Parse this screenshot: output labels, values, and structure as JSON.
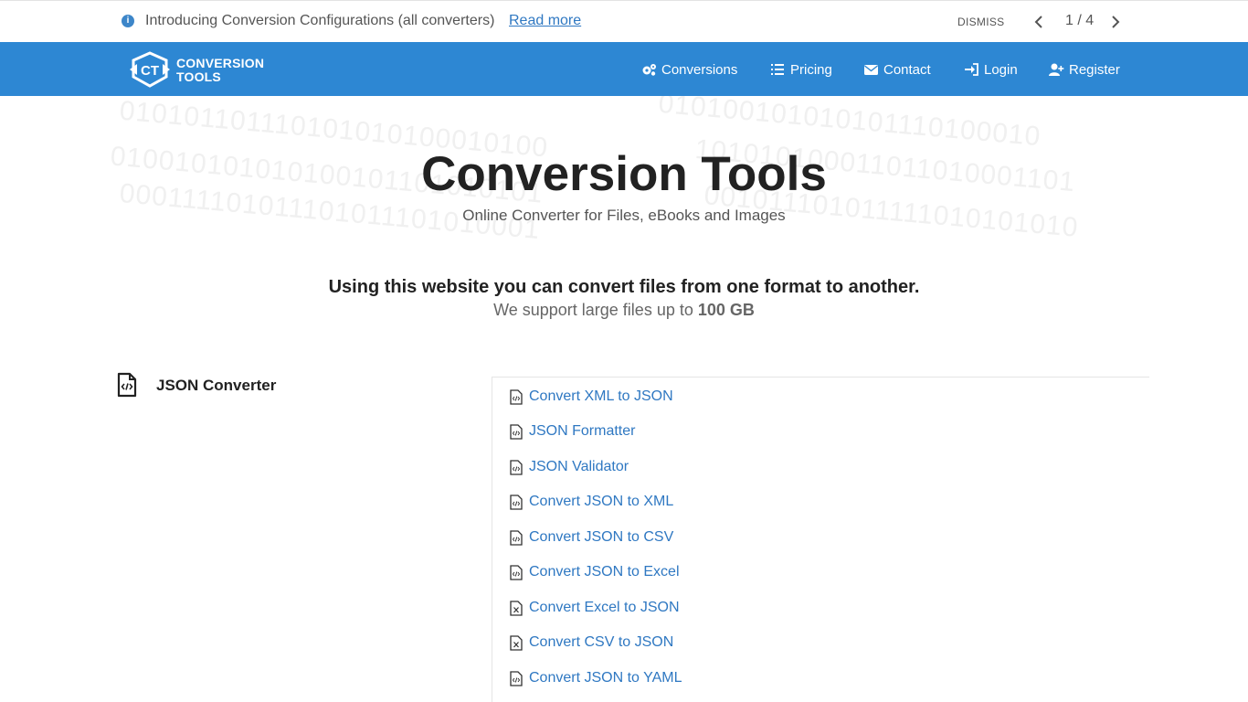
{
  "announcement": {
    "message": "Introducing Conversion Configurations (all converters)",
    "link_label": "Read more",
    "dismiss_label": "DISMISS",
    "pager": "1 / 4"
  },
  "brand": {
    "line1": "CONVERSION",
    "line2": "TOOLS",
    "logo_mark": "CT"
  },
  "nav": {
    "items": [
      {
        "label": "Conversions",
        "icon": "cogs-icon"
      },
      {
        "label": "Pricing",
        "icon": "list-icon"
      },
      {
        "label": "Contact",
        "icon": "envelope-icon"
      },
      {
        "label": "Login",
        "icon": "sign-in-icon"
      },
      {
        "label": "Register",
        "icon": "user-plus-icon"
      }
    ]
  },
  "hero": {
    "title": "Conversion Tools",
    "subtitle": "Online Converter for Files, eBooks and Images"
  },
  "intro": {
    "headline": "Using this website you can convert files from one format to another.",
    "support_prefix": "We support large files up to",
    "support_size": "100 GB"
  },
  "category": {
    "title": "JSON Converter",
    "links": [
      {
        "label": "Convert XML to JSON",
        "icon": "file-code-icon"
      },
      {
        "label": "JSON Formatter",
        "icon": "file-code-icon"
      },
      {
        "label": "JSON Validator",
        "icon": "file-code-icon"
      },
      {
        "label": "Convert JSON to XML",
        "icon": "file-code-icon"
      },
      {
        "label": "Convert JSON to CSV",
        "icon": "file-code-icon"
      },
      {
        "label": "Convert JSON to Excel",
        "icon": "file-code-icon"
      },
      {
        "label": "Convert Excel to JSON",
        "icon": "file-excel-icon"
      },
      {
        "label": "Convert CSV to JSON",
        "icon": "file-excel-icon"
      },
      {
        "label": "Convert JSON to YAML",
        "icon": "file-code-icon"
      }
    ]
  },
  "colors": {
    "brand_blue": "#2d87d3",
    "link_blue": "#2f78c2"
  }
}
